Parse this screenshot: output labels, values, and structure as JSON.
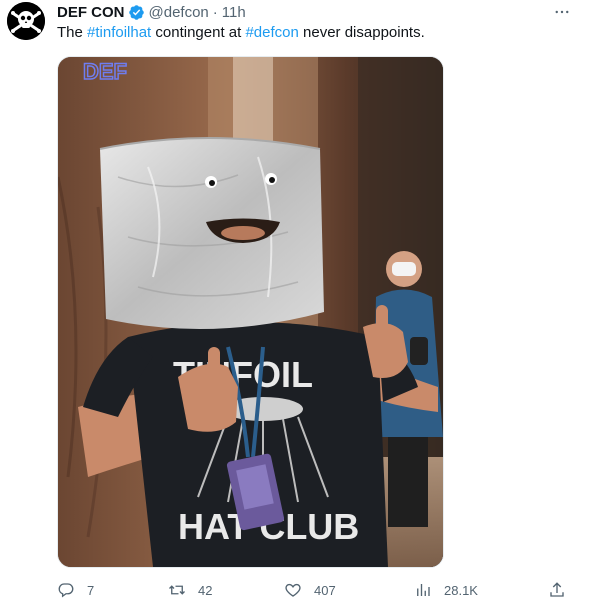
{
  "tweet": {
    "author_name": "DEF CON",
    "handle": "@defcon",
    "separator": "·",
    "time": "11h",
    "text_parts": {
      "prefix": "The ",
      "hashtag1": "#tinfoilhat",
      "middle": " contingent at ",
      "hashtag2": "#defcon",
      "suffix": " never disappoints."
    },
    "media_alt_shirt_text_top": "TINFOIL",
    "media_alt_shirt_text_bottom": "HAT CLUB",
    "actions": {
      "replies": "7",
      "retweets": "42",
      "likes": "407",
      "views": "28.1K"
    },
    "colors": {
      "accent": "#1d9bf0",
      "muted": "#536471",
      "text": "#0f1419"
    },
    "icons": {
      "verified": "verified-badge-icon",
      "more": "more-icon",
      "reply": "reply-icon",
      "retweet": "retweet-icon",
      "like": "heart-icon",
      "views": "views-icon",
      "share": "share-icon"
    }
  }
}
